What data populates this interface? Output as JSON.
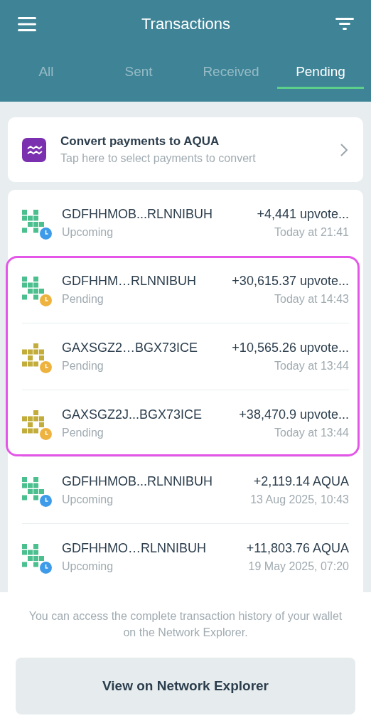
{
  "header": {
    "title": "Transactions"
  },
  "tabs": [
    {
      "label": "All",
      "selected": false
    },
    {
      "label": "Sent",
      "selected": false
    },
    {
      "label": "Received",
      "selected": false
    },
    {
      "label": "Pending",
      "selected": true
    }
  ],
  "convert_banner": {
    "title": "Convert payments to AQUA",
    "subtitle": "Tap here to select payments to convert"
  },
  "transaction_groups": [
    {
      "highlighted": false,
      "rows": [
        {
          "address": "GDFHHMOB...RLNNIBUH",
          "amount": "+4,441 upvote...",
          "status": "Upcoming",
          "kind": "upcoming",
          "time": "Today at 21:41",
          "color": "#4cbf8f"
        }
      ]
    },
    {
      "highlighted": true,
      "rows": [
        {
          "address": "GDFHHM…RLNNIBUH",
          "amount": "+30,615.37 upvote...",
          "status": "Pending",
          "kind": "pending",
          "time": "Today at 14:43",
          "color": "#4cbf8f"
        },
        {
          "address": "GAXSGZ2…BGX73ICE",
          "amount": "+10,565.26 upvote...",
          "status": "Pending",
          "kind": "pending",
          "time": "Today at 13:44",
          "color": "#c2ad3c"
        },
        {
          "address": "GAXSGZ2J...BGX73ICE",
          "amount": "+38,470.9 upvote...",
          "status": "Pending",
          "kind": "pending",
          "time": "Today at 13:44",
          "color": "#c2ad3c"
        }
      ]
    },
    {
      "highlighted": false,
      "rows": [
        {
          "address": "GDFHHMOB...RLNNIBUH",
          "amount": "+2,119.14 AQUA",
          "status": "Upcoming",
          "kind": "upcoming",
          "time": "13 Aug 2025, 10:43",
          "color": "#4cbf8f"
        },
        {
          "address": "GDFHHMO…RLNNIBUH",
          "amount": "+11,803.76 AQUA",
          "status": "Upcoming",
          "kind": "upcoming",
          "time": "19 May 2025, 07:20",
          "color": "#4cbf8f"
        }
      ]
    }
  ],
  "footer": {
    "note": "You can access the complete transaction history of your wallet on the Network Explorer.",
    "button": "View on Network Explorer"
  }
}
